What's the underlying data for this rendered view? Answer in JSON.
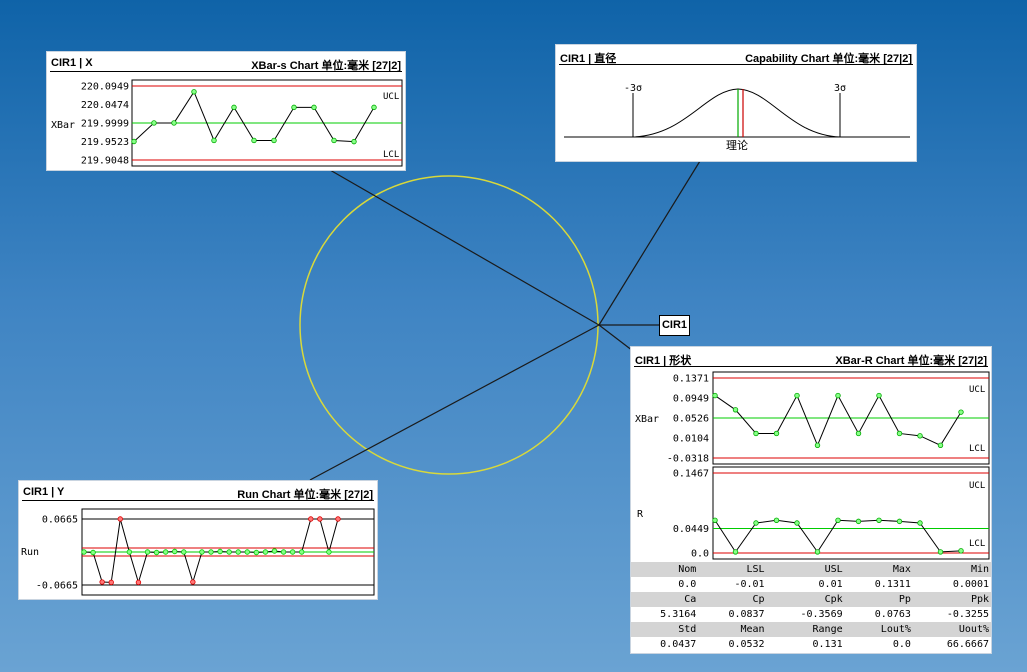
{
  "feature_label": "CIR1",
  "xbar_s_panel": {
    "title_left": "CIR1 | X",
    "title_right": "XBar-s Chart 单位:毫米 [27|2]",
    "y_axis_label": "XBar",
    "ucl_label": "UCL",
    "lcl_label": "LCL",
    "ticks": [
      "220.0949",
      "220.0474",
      "219.9999",
      "219.9523",
      "219.9048"
    ],
    "chart_data": {
      "type": "line",
      "ylim": [
        219.9048,
        220.0949
      ],
      "ucl": 220.0949,
      "center": 219.9999,
      "lcl": 219.9048,
      "values": [
        219.9523,
        220.0,
        220.0,
        220.08,
        219.955,
        220.04,
        219.955,
        219.955,
        220.04,
        220.04,
        219.955,
        219.952,
        220.04
      ]
    }
  },
  "capability_panel": {
    "title_left": "CIR1 | 直径",
    "title_right": "Capability Chart 单位:毫米 [27|2]",
    "left_sigma_label": "-3σ",
    "right_sigma_label": "3σ",
    "nominal_label": "理论",
    "colors": {
      "curve": "#000000",
      "nominal_line": "#00aa00",
      "mean_line": "#cc0000"
    }
  },
  "run_panel": {
    "title_left": "CIR1 | Y",
    "title_right": "Run Chart 单位:毫米 [27|2]",
    "y_axis_label": "Run",
    "ticks": [
      "0.0665",
      "-0.0665"
    ],
    "chart_data": {
      "type": "line",
      "ylim": [
        -0.0665,
        0.0665
      ],
      "upper_limit": 0.0665,
      "lower_limit": -0.0665,
      "values": [
        0.0,
        -0.001,
        -0.0605,
        -0.0612,
        0.0665,
        0.0,
        -0.0612,
        0.0,
        -0.001,
        0.0,
        0.001,
        0.0,
        -0.0605,
        0.0,
        0.0,
        0.001,
        0.0,
        0.0,
        0.0,
        -0.001,
        0.0,
        0.002,
        0.0,
        0.0,
        0.0,
        0.0665,
        0.0665,
        0.0,
        0.0665
      ],
      "out_of_limit_color": "#dd0000",
      "in_limit_color": "#00cc00"
    }
  },
  "shape_panel": {
    "title_left": "CIR1 | 形状",
    "title_right": "XBar-R Chart 单位:毫米 [27|2]",
    "xbar": {
      "y_axis_label": "XBar",
      "ucl_label": "UCL",
      "lcl_label": "LCL",
      "ticks": [
        "0.1371",
        "0.0949",
        "0.0526",
        "0.0104",
        "-0.0318"
      ],
      "chart_data": {
        "type": "line",
        "ylim": [
          -0.0318,
          0.1371
        ],
        "ucl": 0.1371,
        "center": 0.0526,
        "lcl": -0.0318,
        "values": [
          0.1,
          0.07,
          0.02,
          0.02,
          0.1,
          -0.005,
          0.1,
          0.02,
          0.1,
          0.02,
          0.015,
          -0.005,
          0.065
        ]
      }
    },
    "range": {
      "y_axis_label": "R",
      "ucl_label": "UCL",
      "lcl_label": "LCL",
      "ticks": [
        "0.1467",
        "0.0449",
        "0.0"
      ],
      "chart_data": {
        "type": "line",
        "ylim": [
          0.0,
          0.1467
        ],
        "ucl": 0.1467,
        "center": 0.0449,
        "lcl": 0.0,
        "values": [
          0.06,
          0.002,
          0.055,
          0.06,
          0.055,
          0.002,
          0.06,
          0.058,
          0.06,
          0.058,
          0.055,
          0.002,
          0.004
        ]
      }
    },
    "stats": {
      "header1": [
        "Nom",
        "LSL",
        "USL",
        "Max",
        "Min"
      ],
      "values1": [
        "0.0",
        "-0.01",
        "0.01",
        "0.1311",
        "0.0001"
      ],
      "header2": [
        "Ca",
        "Cp",
        "Cpk",
        "Pp",
        "Ppk"
      ],
      "values2": [
        "5.3164",
        "0.0837",
        "-0.3569",
        "0.0763",
        "-0.3255"
      ],
      "header3": [
        "Std",
        "Mean",
        "Range",
        "Lout%",
        "Uout%"
      ],
      "values3": [
        "0.0437",
        "0.0532",
        "0.131",
        "0.0",
        "66.6667"
      ]
    }
  },
  "colors": {
    "ucl_lcl": "#dd0000",
    "center": "#00cc00",
    "point_fill": "#88ff88",
    "circle": "#d9d93a"
  }
}
